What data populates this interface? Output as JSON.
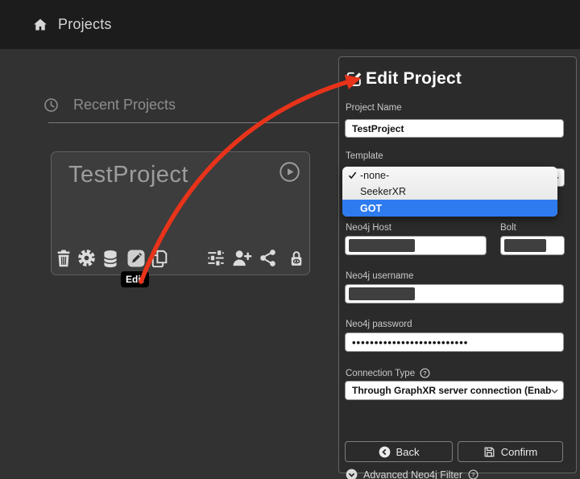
{
  "colors": {
    "accent_blue": "#2e7bf0",
    "arrow_red": "#e8331a",
    "panel_bg": "#2b2b2b",
    "page_bg": "#323232"
  },
  "header": {
    "title": "Projects"
  },
  "main": {
    "section_title": "Recent Projects"
  },
  "card": {
    "title": "TestProject",
    "edit_tooltip": "Edit",
    "icons": [
      "trash-icon",
      "gear-icon",
      "database-icon",
      "edit-icon",
      "copy-icon",
      "sliders-icon",
      "user-plus-icon",
      "share-icon",
      "lock-eye-icon",
      "play-circle-icon"
    ]
  },
  "panel": {
    "title": "Edit Project",
    "project_name": {
      "label": "Project Name",
      "value": "TestProject"
    },
    "template": {
      "label": "Template",
      "options": [
        {
          "label": "-none-"
        },
        {
          "label": "SeekerXR"
        },
        {
          "label": "GOT"
        }
      ],
      "checked_option": "-none-",
      "highlighted_option": "GOT"
    },
    "neo4j_host": {
      "label": "Neo4j Host"
    },
    "bolt": {
      "label": "Bolt"
    },
    "neo4j_username": {
      "label": "Neo4j username"
    },
    "neo4j_password": {
      "label": "Neo4j password",
      "value": "••••••••••••••••••••••••••"
    },
    "connection_type": {
      "label": "Connection Type",
      "value": "Through GraphXR server connection (Enables project sha"
    },
    "advanced_filter": {
      "label": "Advanced Neo4j Filter"
    },
    "back_button": "Back",
    "confirm_button": "Confirm"
  }
}
